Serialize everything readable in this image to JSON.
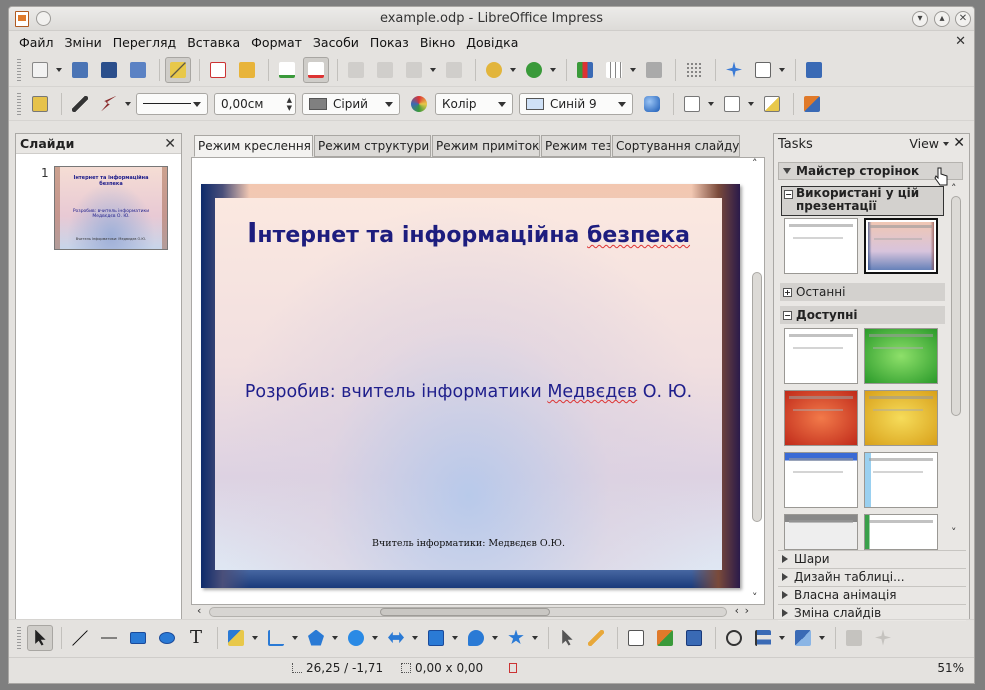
{
  "window": {
    "title": "example.odp - LibreOffice Impress"
  },
  "menu": [
    "Файл",
    "Зміни",
    "Перегляд",
    "Вставка",
    "Формат",
    "Засоби",
    "Показ",
    "Вікно",
    "Довідка"
  ],
  "line_style": {
    "width": "0,00см",
    "line_color": "Сірий",
    "area_type": "Колір",
    "area_color": "Синій 9"
  },
  "colors": {
    "line_color_swatch": "#808080",
    "area_color_swatch": "#cfe1f7"
  },
  "slides_pane": {
    "title": "Слайди",
    "slide_number": "1",
    "thumb": {
      "title": "Інтернет та інформаційна безпека",
      "subtitle": "Розробив: вчитель інформатики Медвєдєв О. Ю.",
      "footer": "Вчитель інформатики: Медвєдєв О.Ю."
    }
  },
  "view_tabs": [
    "Режим креслення",
    "Режим структури",
    "Режим приміток",
    "Режим тез",
    "Сортування слайду"
  ],
  "slide": {
    "title_first": "І",
    "title_rest_a": "нтернет та інформаційна ",
    "title_rest_b": "безпека",
    "subtitle_a": "Розробив: вчитель інформатики ",
    "subtitle_b": "Медвєдєв",
    "subtitle_c": " О. Ю.",
    "footer": "Вчитель інформатики: Медвєдєв О.Ю."
  },
  "tasks": {
    "title": "Tasks",
    "view": "View",
    "master_pages": "Майстер сторінок",
    "used": "Використані у цій презентації",
    "recent": "Останні",
    "available": "Доступні",
    "layers": "Шари",
    "table_design": "Дизайн таблиці...",
    "custom_animation": "Власна анімація",
    "slide_transition": "Зміна слайдів"
  },
  "status": {
    "position": "26,25 / -1,71",
    "size": "0,00 x 0,00",
    "zoom": "51%"
  }
}
